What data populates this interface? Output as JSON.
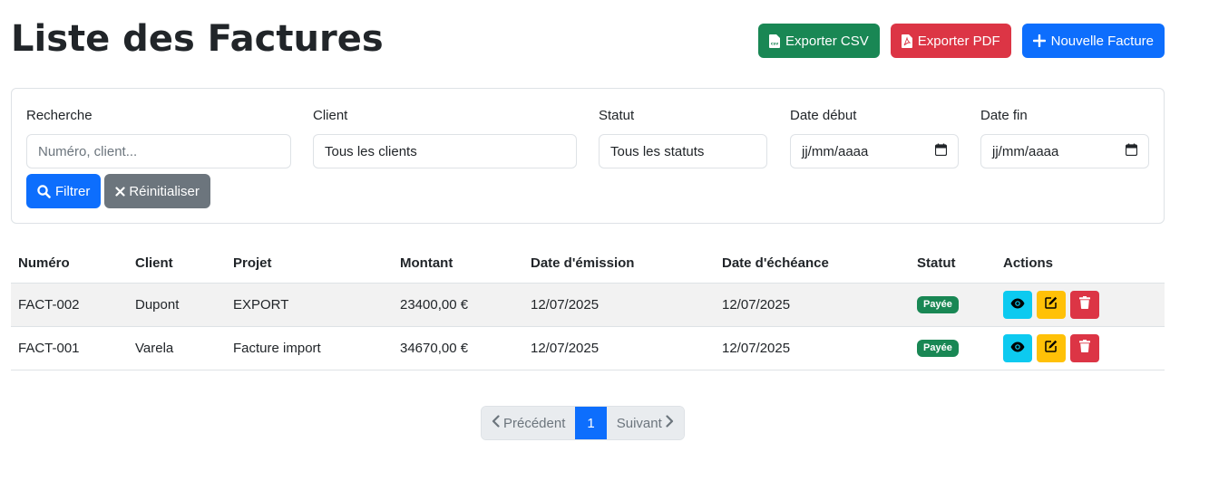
{
  "header": {
    "title": "Liste des Factures",
    "export_csv_label": "Exporter CSV",
    "export_pdf_label": "Exporter PDF",
    "new_invoice_label": "Nouvelle Facture"
  },
  "filters": {
    "search": {
      "label": "Recherche",
      "placeholder": "Numéro, client..."
    },
    "client": {
      "label": "Client",
      "value": "Tous les clients"
    },
    "status": {
      "label": "Statut",
      "value": "Tous les statuts"
    },
    "date_start": {
      "label": "Date début",
      "placeholder": "jj/mm/aaaa"
    },
    "date_end": {
      "label": "Date fin",
      "placeholder": "jj/mm/aaaa"
    },
    "filter_label": "Filtrer",
    "reset_label": "Réinitialiser"
  },
  "table": {
    "columns": [
      "Numéro",
      "Client",
      "Projet",
      "Montant",
      "Date d'émission",
      "Date d'échéance",
      "Statut",
      "Actions"
    ],
    "rows": [
      {
        "numero": "FACT-002",
        "client": "Dupont",
        "projet": "EXPORT",
        "montant": "23400,00 €",
        "emission": "12/07/2025",
        "echeance": "12/07/2025",
        "statut": "Payée"
      },
      {
        "numero": "FACT-001",
        "client": "Varela",
        "projet": "Facture import",
        "montant": "34670,00 €",
        "emission": "12/07/2025",
        "echeance": "12/07/2025",
        "statut": "Payée"
      }
    ]
  },
  "pagination": {
    "prev_label": "Précédent",
    "current_page": "1",
    "next_label": "Suivant"
  },
  "colors": {
    "primary": "#0d6efd",
    "success": "#198754",
    "danger": "#dc3545",
    "warning": "#ffc107",
    "info": "#0dcaf0",
    "secondary": "#6c757d"
  },
  "icons": {
    "export_csv": "csv-file-icon",
    "export_pdf": "pdf-file-icon",
    "new_invoice": "plus-icon",
    "filter": "search-icon",
    "reset": "close-icon",
    "view": "eye-icon",
    "edit": "edit-icon",
    "delete": "trash-icon",
    "prev": "chevron-left-icon",
    "next": "chevron-right-icon"
  }
}
